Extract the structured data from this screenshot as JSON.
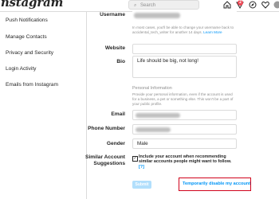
{
  "app": {
    "logo": "Instagram",
    "search_placeholder": "Search",
    "notification_count": "2"
  },
  "sidebar": {
    "items": [
      {
        "label": "Push Notifications"
      },
      {
        "label": "Manage Contacts"
      },
      {
        "label": "Privacy and Security"
      },
      {
        "label": "Login Activity"
      },
      {
        "label": "Emails from Instagram"
      }
    ]
  },
  "form": {
    "username": {
      "label": "Username"
    },
    "username_help": "In most cases, you'll be able to change your username back to",
    "username_help2": "accidental_tech_writer for another 14 days.",
    "learn_more": "Learn More",
    "website": {
      "label": "Website",
      "value": ""
    },
    "bio": {
      "label": "Bio",
      "value": "Life should be big, not long!"
    },
    "personal_info": {
      "title": "Personal Information",
      "desc1": "Provide your personal information, even if the account is used",
      "desc2": "for a business, a pet or something else. This won't be a part of",
      "desc3": "your public profile."
    },
    "email": {
      "label": "Email"
    },
    "phone": {
      "label": "Phone Number"
    },
    "gender": {
      "label": "Gender",
      "value": "Male"
    },
    "suggestions": {
      "label_line1": "Similar Account",
      "label_line2": "Suggestions",
      "checkbox_text": "Include your account when recommending similar accounts people might want to follow.",
      "help": "[?]",
      "checked": true
    },
    "submit_label": "Submit",
    "disable_link": "Temporarily disable my account"
  },
  "colors": {
    "link": "#0095f6",
    "highlight_border": "#d0021b",
    "submit_disabled": "#b2dffc"
  }
}
